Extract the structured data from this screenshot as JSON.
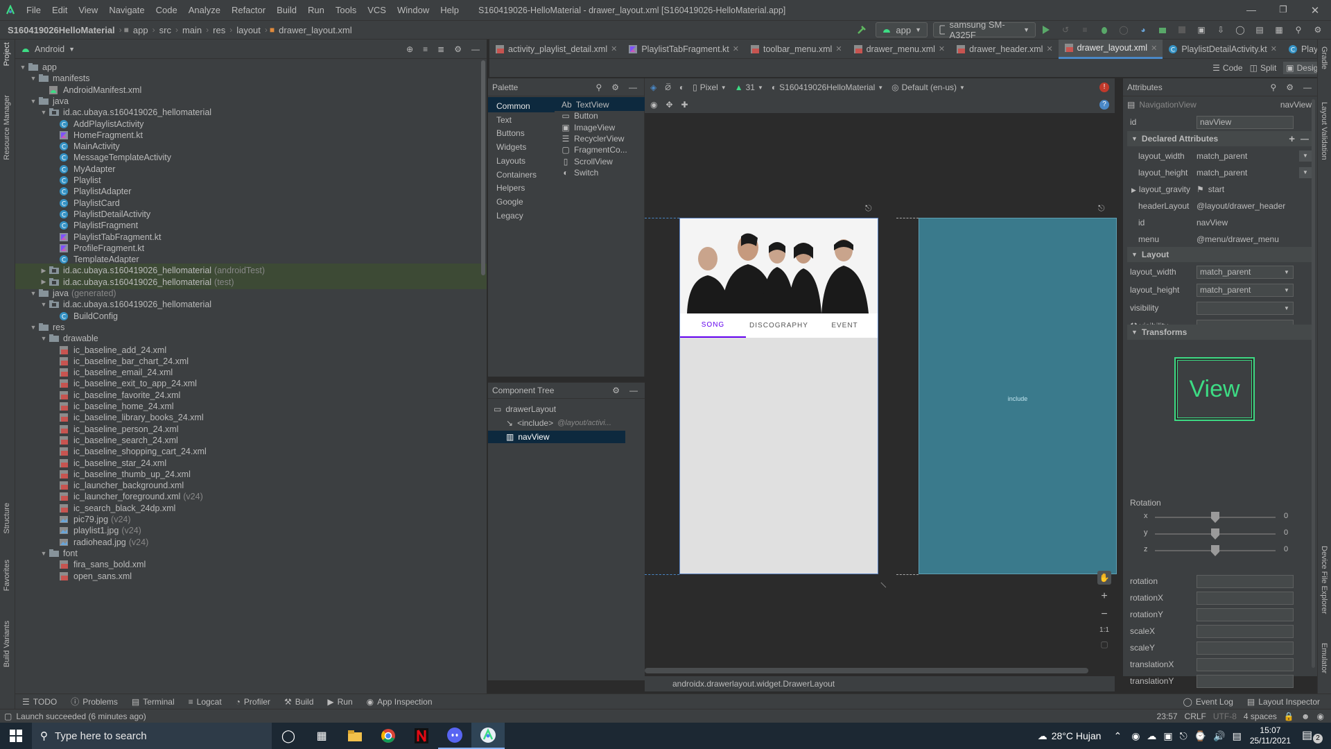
{
  "window": {
    "menu": [
      "File",
      "Edit",
      "View",
      "Navigate",
      "Code",
      "Analyze",
      "Refactor",
      "Build",
      "Run",
      "Tools",
      "VCS",
      "Window",
      "Help"
    ],
    "title": "S160419026-HelloMaterial - drawer_layout.xml [S160419026-HelloMaterial.app]"
  },
  "breadcrumbs": [
    "S160419026HelloMaterial",
    "app",
    "src",
    "main",
    "res",
    "layout",
    "drawer_layout.xml"
  ],
  "toolbar": {
    "run_config": "app",
    "device": "samsung SM-A325F"
  },
  "left_strip": [
    "Project",
    "Resource Manager",
    "Structure",
    "Favorites",
    "Build Variants"
  ],
  "right_strip": [
    "Gradle",
    "Layout Validation",
    "Device File Explorer",
    "Emulator"
  ],
  "project": {
    "view_selector": "Android",
    "tree": [
      {
        "level": 0,
        "arrow": "down",
        "icon": "folder",
        "label": "app"
      },
      {
        "level": 1,
        "arrow": "down",
        "icon": "folder",
        "label": "manifests"
      },
      {
        "level": 2,
        "arrow": "",
        "icon": "manifest",
        "label": "AndroidManifest.xml"
      },
      {
        "level": 1,
        "arrow": "down",
        "icon": "folder",
        "label": "java"
      },
      {
        "level": 2,
        "arrow": "down",
        "icon": "package",
        "label": "id.ac.ubaya.s160419026_hellomaterial"
      },
      {
        "level": 3,
        "arrow": "",
        "icon": "class",
        "label": "AddPlaylistActivity"
      },
      {
        "level": 3,
        "arrow": "",
        "icon": "kt",
        "label": "HomeFragment.kt"
      },
      {
        "level": 3,
        "arrow": "",
        "icon": "class",
        "label": "MainActivity"
      },
      {
        "level": 3,
        "arrow": "",
        "icon": "class",
        "label": "MessageTemplateActivity"
      },
      {
        "level": 3,
        "arrow": "",
        "icon": "class",
        "label": "MyAdapter"
      },
      {
        "level": 3,
        "arrow": "",
        "icon": "class",
        "label": "Playlist"
      },
      {
        "level": 3,
        "arrow": "",
        "icon": "class",
        "label": "PlaylistAdapter"
      },
      {
        "level": 3,
        "arrow": "",
        "icon": "class",
        "label": "PlaylistCard"
      },
      {
        "level": 3,
        "arrow": "",
        "icon": "class",
        "label": "PlaylistDetailActivity"
      },
      {
        "level": 3,
        "arrow": "",
        "icon": "class",
        "label": "PlaylistFragment"
      },
      {
        "level": 3,
        "arrow": "",
        "icon": "kt",
        "label": "PlaylistTabFragment.kt"
      },
      {
        "level": 3,
        "arrow": "",
        "icon": "kt",
        "label": "ProfileFragment.kt"
      },
      {
        "level": 3,
        "arrow": "",
        "icon": "class",
        "label": "TemplateAdapter"
      },
      {
        "level": 2,
        "arrow": "right",
        "icon": "package",
        "label": "id.ac.ubaya.s160419026_hellomaterial",
        "note": "(androidTest)",
        "hl": true
      },
      {
        "level": 2,
        "arrow": "right",
        "icon": "package",
        "label": "id.ac.ubaya.s160419026_hellomaterial",
        "note": "(test)",
        "hl": true
      },
      {
        "level": 1,
        "arrow": "down",
        "icon": "folder",
        "label": "java",
        "note": "(generated)"
      },
      {
        "level": 2,
        "arrow": "down",
        "icon": "package",
        "label": "id.ac.ubaya.s160419026_hellomaterial"
      },
      {
        "level": 3,
        "arrow": "",
        "icon": "class",
        "label": "BuildConfig"
      },
      {
        "level": 1,
        "arrow": "down",
        "icon": "folder",
        "label": "res"
      },
      {
        "level": 2,
        "arrow": "down",
        "icon": "folder",
        "label": "drawable"
      },
      {
        "level": 3,
        "arrow": "",
        "icon": "xml",
        "label": "ic_baseline_add_24.xml"
      },
      {
        "level": 3,
        "arrow": "",
        "icon": "xml",
        "label": "ic_baseline_bar_chart_24.xml"
      },
      {
        "level": 3,
        "arrow": "",
        "icon": "xml",
        "label": "ic_baseline_email_24.xml"
      },
      {
        "level": 3,
        "arrow": "",
        "icon": "xml",
        "label": "ic_baseline_exit_to_app_24.xml"
      },
      {
        "level": 3,
        "arrow": "",
        "icon": "xml",
        "label": "ic_baseline_favorite_24.xml"
      },
      {
        "level": 3,
        "arrow": "",
        "icon": "xml",
        "label": "ic_baseline_home_24.xml"
      },
      {
        "level": 3,
        "arrow": "",
        "icon": "xml",
        "label": "ic_baseline_library_books_24.xml"
      },
      {
        "level": 3,
        "arrow": "",
        "icon": "xml",
        "label": "ic_baseline_person_24.xml"
      },
      {
        "level": 3,
        "arrow": "",
        "icon": "xml",
        "label": "ic_baseline_search_24.xml"
      },
      {
        "level": 3,
        "arrow": "",
        "icon": "xml",
        "label": "ic_baseline_shopping_cart_24.xml"
      },
      {
        "level": 3,
        "arrow": "",
        "icon": "xml",
        "label": "ic_baseline_star_24.xml"
      },
      {
        "level": 3,
        "arrow": "",
        "icon": "xml",
        "label": "ic_baseline_thumb_up_24.xml"
      },
      {
        "level": 3,
        "arrow": "",
        "icon": "xml",
        "label": "ic_launcher_background.xml"
      },
      {
        "level": 3,
        "arrow": "",
        "icon": "xml",
        "label": "ic_launcher_foreground.xml",
        "note": "(v24)"
      },
      {
        "level": 3,
        "arrow": "",
        "icon": "xml",
        "label": "ic_search_black_24dp.xml"
      },
      {
        "level": 3,
        "arrow": "",
        "icon": "image",
        "label": "pic79.jpg",
        "note": "(v24)"
      },
      {
        "level": 3,
        "arrow": "",
        "icon": "image",
        "label": "playlist1.jpg",
        "note": "(v24)"
      },
      {
        "level": 3,
        "arrow": "",
        "icon": "image",
        "label": "radiohead.jpg",
        "note": "(v24)"
      },
      {
        "level": 2,
        "arrow": "down",
        "icon": "folder",
        "label": "font"
      },
      {
        "level": 3,
        "arrow": "",
        "icon": "xml",
        "label": "fira_sans_bold.xml"
      },
      {
        "level": 3,
        "arrow": "",
        "icon": "xml",
        "label": "open_sans.xml"
      }
    ]
  },
  "editor_tabs": [
    {
      "label": "activity_playlist_detail.xml",
      "icon": "xml"
    },
    {
      "label": "PlaylistTabFragment.kt",
      "icon": "kt"
    },
    {
      "label": "toolbar_menu.xml",
      "icon": "xml"
    },
    {
      "label": "drawer_menu.xml",
      "icon": "xml"
    },
    {
      "label": "drawer_header.xml",
      "icon": "xml"
    },
    {
      "label": "drawer_layout.xml",
      "icon": "xml",
      "active": true
    },
    {
      "label": "PlaylistDetailActivity.kt",
      "icon": "class"
    },
    {
      "label": "Play",
      "icon": "class"
    }
  ],
  "mode_buttons": [
    "Code",
    "Split",
    "Design"
  ],
  "palette": {
    "title": "Palette",
    "categories": [
      "Common",
      "Text",
      "Buttons",
      "Widgets",
      "Layouts",
      "Containers",
      "Helpers",
      "Google",
      "Legacy"
    ],
    "items": [
      {
        "prefix": "Ab",
        "label": "TextView"
      },
      {
        "label": "Button"
      },
      {
        "label": "ImageView"
      },
      {
        "label": "RecyclerView"
      },
      {
        "label": "FragmentCo..."
      },
      {
        "label": "ScrollView"
      },
      {
        "label": "Switch"
      }
    ]
  },
  "component_tree": {
    "title": "Component Tree",
    "items": [
      {
        "label": "drawerLayout"
      },
      {
        "label": "<include>",
        "note": "@layout/activi..."
      },
      {
        "label": "navView",
        "selected": true
      }
    ]
  },
  "design_toolbar": {
    "device": "Pixel",
    "api": "31",
    "theme": "S160419026HelloMaterial",
    "locale": "Default (en-us)"
  },
  "preview": {
    "tabs": [
      "SONG",
      "DISCOGRAPHY",
      "EVENT"
    ],
    "selected_tab": "SONG",
    "include_label": "include",
    "accent": "#6200ee",
    "blueprint_color": "#3a7a8c"
  },
  "zoom_fit_label": "1:1",
  "canvas_status": "androidx.drawerlayout.widget.DrawerLayout",
  "attributes": {
    "title": "Attributes",
    "component": "NavigationView",
    "component_id": "navView",
    "id_label": "id",
    "id_value": "navView",
    "declared_title": "Declared Attributes",
    "declared": [
      {
        "name": "layout_width",
        "value": "match_parent",
        "dropdown": true
      },
      {
        "name": "layout_height",
        "value": "match_parent",
        "dropdown": true
      },
      {
        "name": "layout_gravity",
        "value": "start",
        "expand": true
      },
      {
        "name": "headerLayout",
        "value": "@layout/drawer_header"
      },
      {
        "name": "id",
        "value": "navView"
      },
      {
        "name": "menu",
        "value": "@menu/drawer_menu"
      }
    ],
    "layout_title": "Layout",
    "layout": [
      {
        "name": "layout_width",
        "value": "match_parent"
      },
      {
        "name": "layout_height",
        "value": "match_parent"
      },
      {
        "name": "visibility",
        "value": ""
      },
      {
        "name": "visibility",
        "value": "",
        "tool": true
      }
    ],
    "transforms_title": "Transforms",
    "view_label": "View",
    "rotation_title": "Rotation",
    "rotation_axes": [
      {
        "axis": "x",
        "value": "0"
      },
      {
        "axis": "y",
        "value": "0"
      },
      {
        "axis": "z",
        "value": "0"
      }
    ],
    "fields": [
      "rotation",
      "rotationX",
      "rotationY",
      "scaleX",
      "scaleY",
      "translationX",
      "translationY"
    ]
  },
  "bottom_tabs": [
    "TODO",
    "Problems",
    "Terminal",
    "Logcat",
    "Profiler",
    "Build",
    "Run",
    "App Inspection"
  ],
  "bottom_right_tabs": [
    "Event Log",
    "Layout Inspector"
  ],
  "status": {
    "message": "Launch succeeded (6 minutes ago)",
    "position": "23:57",
    "line_sep": "CRLF",
    "encoding": "UTF-8",
    "indent": "4 spaces"
  },
  "taskbar": {
    "search_placeholder": "Type here to search",
    "weather": "28°C Hujan",
    "time": "15:07",
    "date": "25/11/2021",
    "notifications": "2"
  }
}
